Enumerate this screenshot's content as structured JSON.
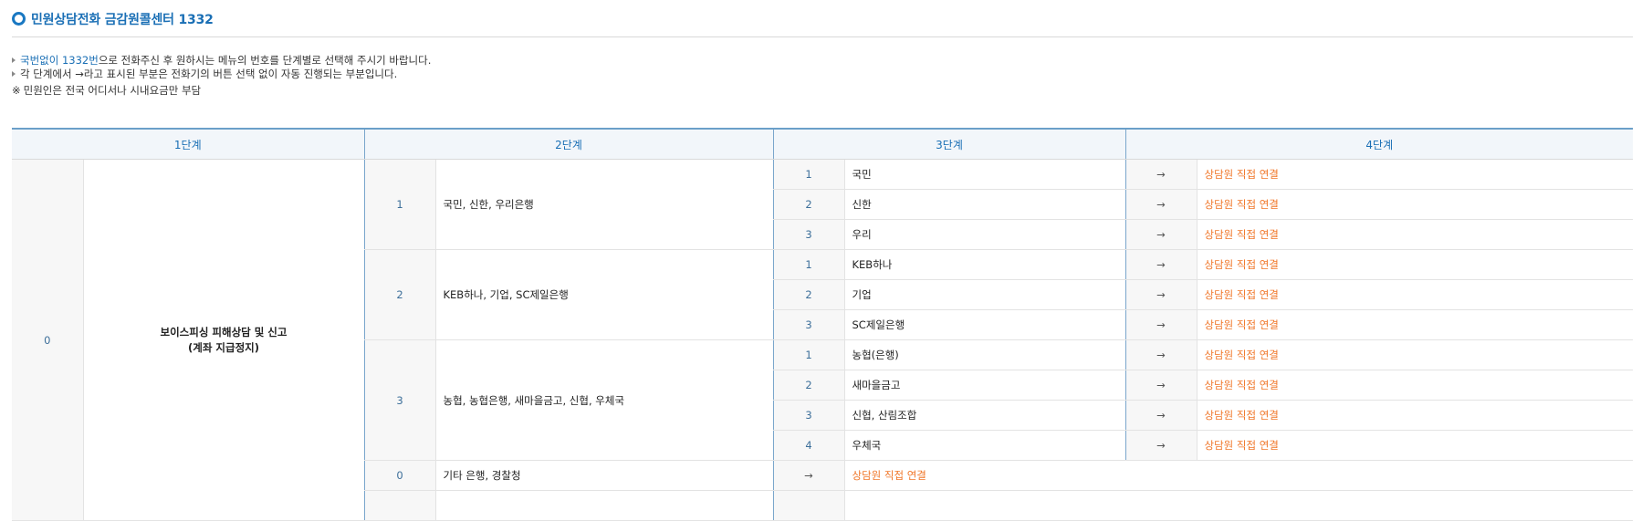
{
  "title": "민원상담전화 금감원콜센터 1332",
  "notes": {
    "line1_prefix": "국번없이 1332번",
    "line1_rest": "으로 전화주신 후 원하시는 메뉴의 번호를 단계별로 선택해 주시기 바랍니다.",
    "line2": "각 단계에서 →라고 표시된 부분은 전화기의 버튼 선택 없이 자동 진행되는 부분입니다.",
    "line3_mark": "※",
    "line3": "민원인은 전국 어디서나 시내요금만 부담"
  },
  "table": {
    "headers": [
      "1단계",
      "2단계",
      "3단계",
      "4단계"
    ],
    "step1": {
      "num": "0",
      "label_line1": "보이스피싱 피해상담 및 신고",
      "label_line2": "(계좌 지급정지)"
    },
    "arrow": "→",
    "connect": "상담원 직접 연결",
    "groups": [
      {
        "num": "1",
        "label": "국민, 신한, 우리은행",
        "items": [
          {
            "num": "1",
            "label": "국민"
          },
          {
            "num": "2",
            "label": "신한"
          },
          {
            "num": "3",
            "label": "우리"
          }
        ]
      },
      {
        "num": "2",
        "label": "KEB하나, 기업, SC제일은행",
        "items": [
          {
            "num": "1",
            "label": "KEB하나"
          },
          {
            "num": "2",
            "label": "기업"
          },
          {
            "num": "3",
            "label": "SC제일은행"
          }
        ]
      },
      {
        "num": "3",
        "label": "농협, 농협은행, 새마을금고, 신협, 우체국",
        "items": [
          {
            "num": "1",
            "label": "농협(은행)"
          },
          {
            "num": "2",
            "label": "새마을금고"
          },
          {
            "num": "3",
            "label": "신협, 산림조합"
          },
          {
            "num": "4",
            "label": "우체국"
          }
        ]
      }
    ],
    "other": {
      "num": "0",
      "label": "기타 은행, 경찰청"
    }
  }
}
